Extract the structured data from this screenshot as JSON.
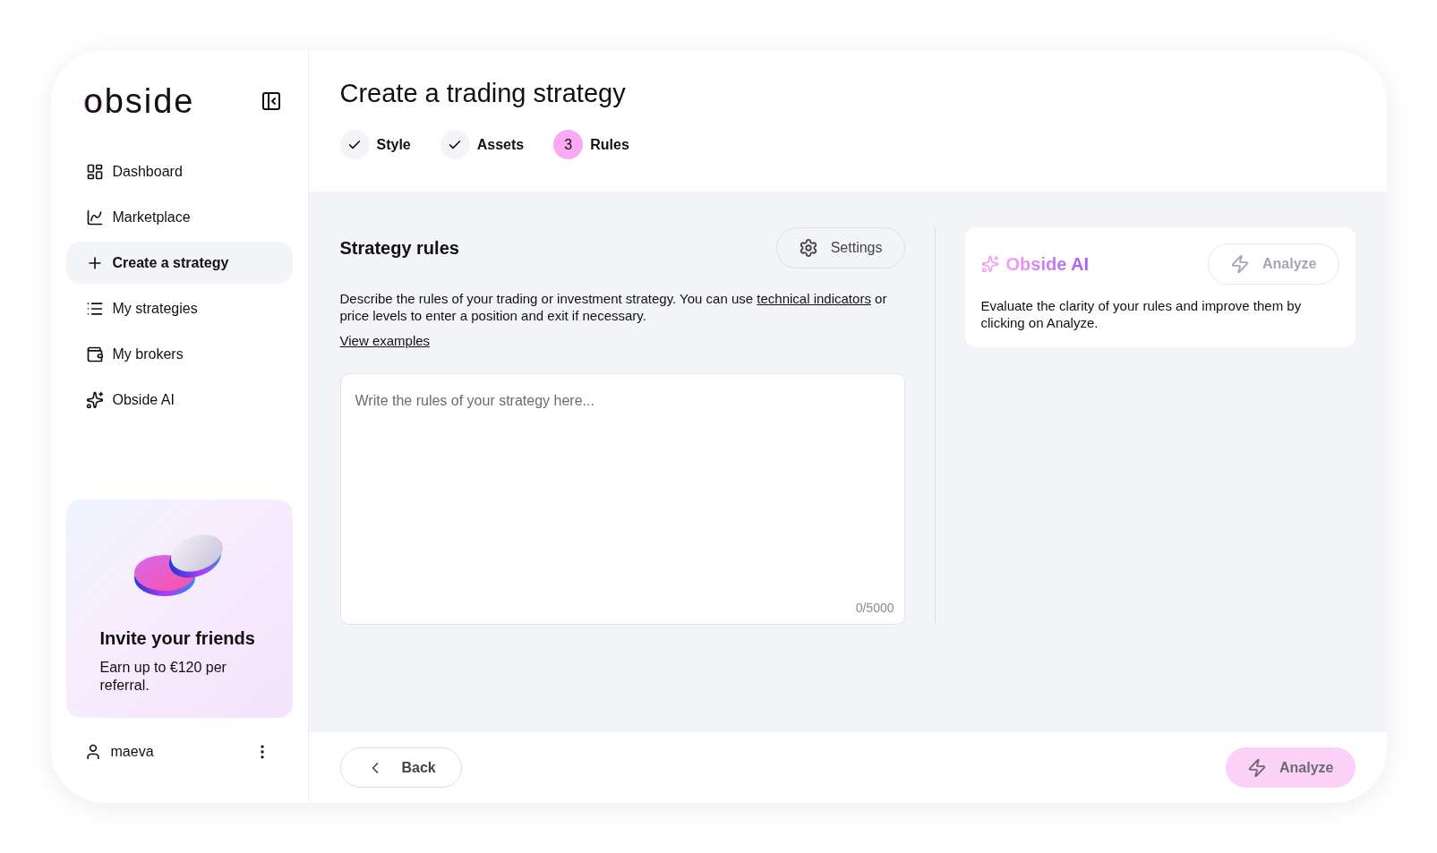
{
  "sidebar": {
    "logo": "obside",
    "items": [
      {
        "kind": "dashboard",
        "label": "Dashboard",
        "selected": false
      },
      {
        "kind": "chart",
        "label": "Marketplace",
        "selected": false
      },
      {
        "kind": "plus",
        "label": "Create a strategy",
        "selected": true
      },
      {
        "kind": "list",
        "label": "My strategies",
        "selected": false
      },
      {
        "kind": "wallet",
        "label": "My brokers",
        "selected": false
      },
      {
        "kind": "sparkles",
        "label": "Obside AI",
        "selected": false
      }
    ],
    "promo": {
      "title": "Invite your friends",
      "text": "Earn up to €120 per referral."
    },
    "user": {
      "name": "maeva"
    }
  },
  "header": {
    "title": "Create a trading strategy",
    "steps": [
      {
        "label": "Style",
        "completed": true,
        "selected": false
      },
      {
        "label": "Assets",
        "completed": true,
        "selected": false
      },
      {
        "label": "Rules",
        "marker": "3",
        "completed": false,
        "selected": true
      }
    ]
  },
  "rules": {
    "title": "Strategy rules",
    "settings_button": "Settings",
    "description": {
      "before": "Describe the rules of your trading or investment strategy. You can use ",
      "link": "technical indicators",
      "after": " or price levels to enter a position and exit if necessary."
    },
    "examples_link": "View examples",
    "editor": {
      "placeholder": "Write the rules of your strategy here...",
      "counter": "0/5000"
    }
  },
  "ai_panel": {
    "title": "Obside AI",
    "button": {
      "label": "Analyze",
      "disabled": true
    },
    "text": "Evaluate the clarity of your rules and improve them by clicking on Analyze."
  },
  "footer": {
    "back": "Back",
    "analyze": {
      "label": "Analyze",
      "disabled": true
    }
  }
}
